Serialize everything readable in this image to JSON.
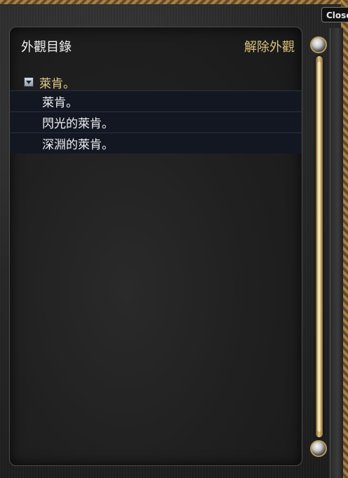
{
  "window": {
    "close_tab_label": "Close"
  },
  "panel": {
    "title": "外觀目錄",
    "remove_appearance_label": "解除外觀"
  },
  "tree": {
    "parent_label": "萊肯。",
    "children": [
      {
        "label": "萊肯。"
      },
      {
        "label": "閃光的萊肯。"
      },
      {
        "label": "深淵的萊肯。"
      }
    ]
  },
  "icons": {
    "expander": "collapse-triangle-icon",
    "scroll_up": "scroll-up-orb-icon",
    "scroll_down": "scroll-down-orb-icon"
  },
  "colors": {
    "title": "#f2f2f2",
    "accent_gold": "#d9c27a",
    "row_bg": "#121722"
  }
}
